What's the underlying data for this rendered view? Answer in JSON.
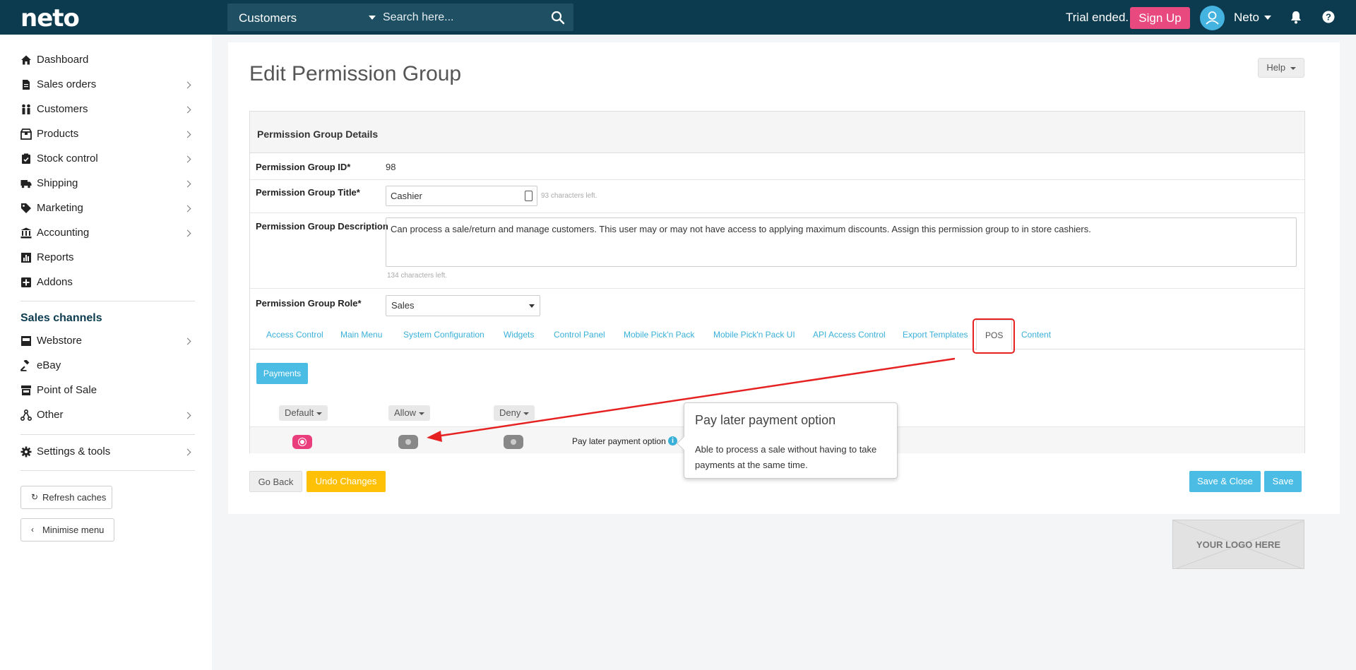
{
  "header": {
    "logo": "neto",
    "search_category": "Customers",
    "search_placeholder": "Search here...",
    "trial_text": "Trial ended.",
    "signup_label": "Sign Up",
    "user_name": "Neto"
  },
  "sidebar": {
    "items": [
      {
        "label": "Dashboard",
        "icon": "home-icon"
      },
      {
        "label": "Sales orders",
        "icon": "document-icon"
      },
      {
        "label": "Customers",
        "icon": "users-icon"
      },
      {
        "label": "Products",
        "icon": "box-icon"
      },
      {
        "label": "Stock control",
        "icon": "clipboard-check-icon"
      },
      {
        "label": "Shipping",
        "icon": "truck-icon"
      },
      {
        "label": "Marketing",
        "icon": "tag-icon"
      },
      {
        "label": "Accounting",
        "icon": "bank-icon"
      },
      {
        "label": "Reports",
        "icon": "chart-icon"
      },
      {
        "label": "Addons",
        "icon": "plus-square-icon"
      }
    ],
    "sales_channels_heading": "Sales channels",
    "channels": [
      {
        "label": "Webstore",
        "icon": "store-icon"
      },
      {
        "label": "eBay",
        "icon": "gavel-icon"
      },
      {
        "label": "Point of Sale",
        "icon": "register-icon"
      },
      {
        "label": "Other",
        "icon": "network-icon"
      }
    ],
    "settings_label": "Settings & tools",
    "refresh_label": "Refresh caches",
    "minimise_label": "Minimise menu"
  },
  "page": {
    "title": "Edit Permission Group",
    "help_label": "Help",
    "panel_title": "Permission Group Details",
    "fields": {
      "id_label": "Permission Group ID*",
      "id_value": "98",
      "title_label": "Permission Group Title*",
      "title_value": "Cashier",
      "title_hint": "93 characters left.",
      "description_label": "Permission Group Description",
      "description_value": "Can process a sale/return and manage customers. This user may or may not have access to applying maximum discounts. Assign this permission group to in store cashiers.",
      "description_hint": "134 characters left.",
      "role_label": "Permission Group Role*",
      "role_value": "Sales"
    },
    "tabs": [
      "Access Control",
      "Main Menu",
      "System Configuration",
      "Widgets",
      "Control Panel",
      "Mobile Pick'n Pack",
      "Mobile Pick'n Pack UI",
      "API Access Control",
      "Export Templates",
      "POS",
      "Content"
    ],
    "active_tab": "POS",
    "subtab_label": "Payments",
    "columns": [
      "Default",
      "Allow",
      "Deny"
    ],
    "permission_label": "Pay later payment option",
    "popover": {
      "title": "Pay later payment option",
      "body": "Able to process a sale without having to take payments at the same time."
    },
    "buttons": {
      "go_back": "Go Back",
      "undo": "Undo Changes",
      "save_close": "Save & Close",
      "save": "Save"
    },
    "logo_placeholder": "YOUR LOGO HERE"
  },
  "colors": {
    "topbar": "#0c3b4f",
    "accent": "#4bbde5",
    "pink": "#e84a7f",
    "warning": "#ffc107",
    "annotation": "#e62121"
  }
}
